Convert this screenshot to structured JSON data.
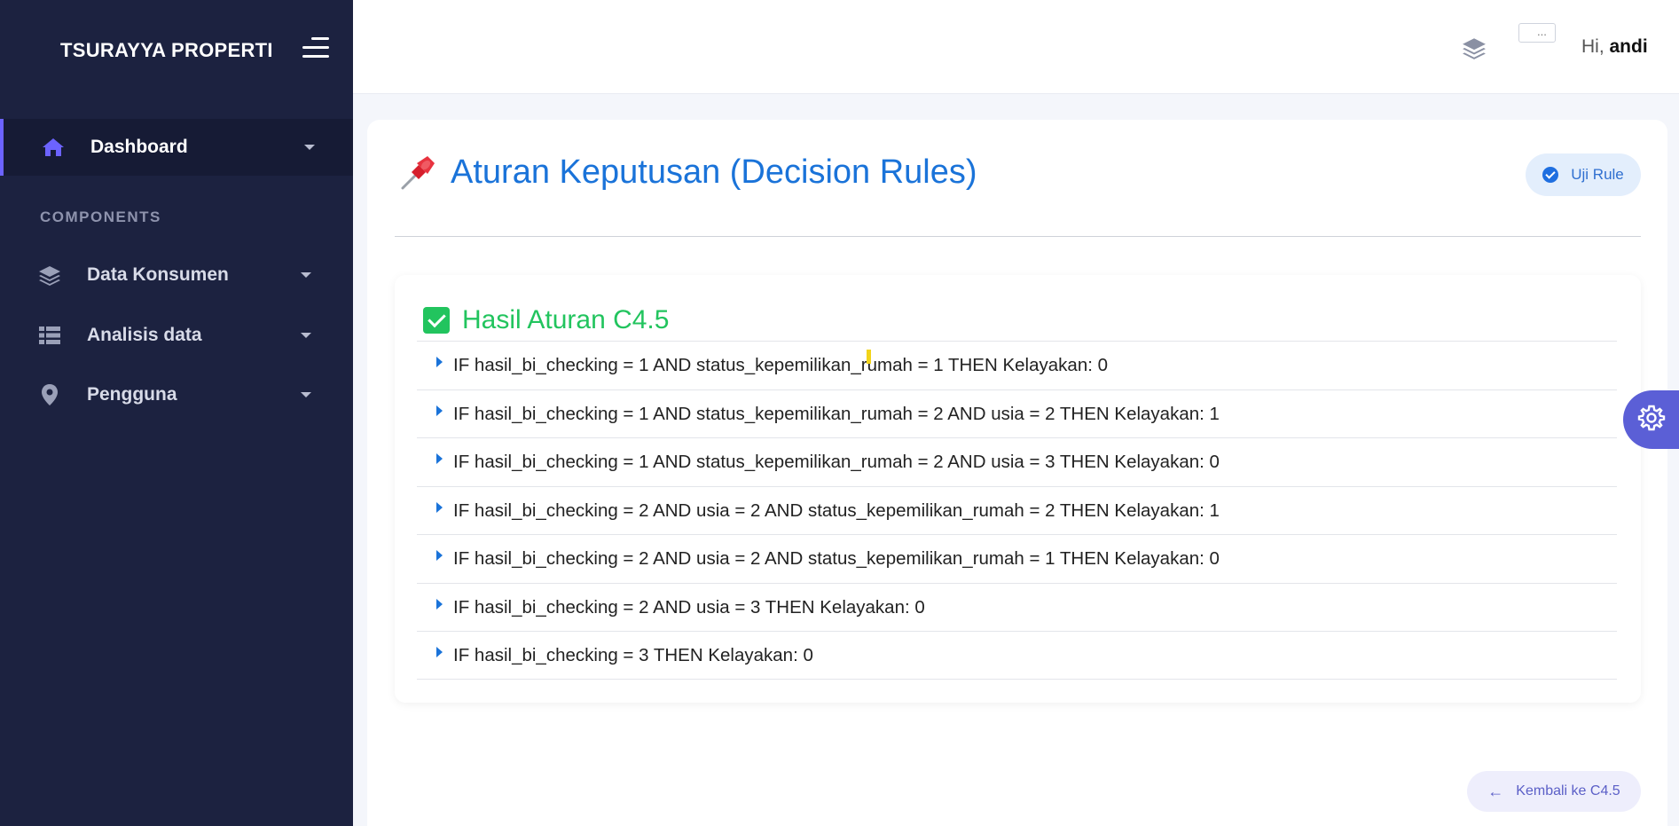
{
  "sidebar": {
    "brand": "TSURAYYA PROPERTI",
    "section_label": "COMPONENTS",
    "items": [
      {
        "label": "Dashboard",
        "icon": "home-icon"
      },
      {
        "label": "Data Konsumen",
        "icon": "layers-icon"
      },
      {
        "label": "Analisis data",
        "icon": "table-icon"
      },
      {
        "label": "Pengguna",
        "icon": "map-pin-icon"
      }
    ]
  },
  "header": {
    "avatar_alt": "...",
    "greeting_prefix": "Hi, ",
    "user_name": "andi"
  },
  "page": {
    "title": "Aturan Keputusan (Decision Rules)",
    "uji_rule_label": "Uji Rule",
    "back_label": "Kembali ke C4.5"
  },
  "rules": {
    "title": "Hasil Aturan C4.5",
    "items": [
      "IF hasil_bi_checking = 1 AND status_kepemilikan_rumah = 1 THEN Kelayakan: 0",
      "IF hasil_bi_checking = 1 AND status_kepemilikan_rumah = 2 AND usia = 2 THEN Kelayakan: 1",
      "IF hasil_bi_checking = 1 AND status_kepemilikan_rumah = 2 AND usia = 3 THEN Kelayakan: 0",
      "IF hasil_bi_checking = 2 AND usia = 2 AND status_kepemilikan_rumah = 2 THEN Kelayakan: 1",
      "IF hasil_bi_checking = 2 AND usia = 2 AND status_kepemilikan_rumah = 1 THEN Kelayakan: 0",
      "IF hasil_bi_checking = 2 AND usia = 3 THEN Kelayakan: 0",
      "IF hasil_bi_checking = 3 THEN Kelayakan: 0"
    ]
  },
  "colors": {
    "sidebar_bg": "#1c2240",
    "accent": "#6c63ff",
    "title_blue": "#1a73d9",
    "success_green": "#22c45e"
  }
}
